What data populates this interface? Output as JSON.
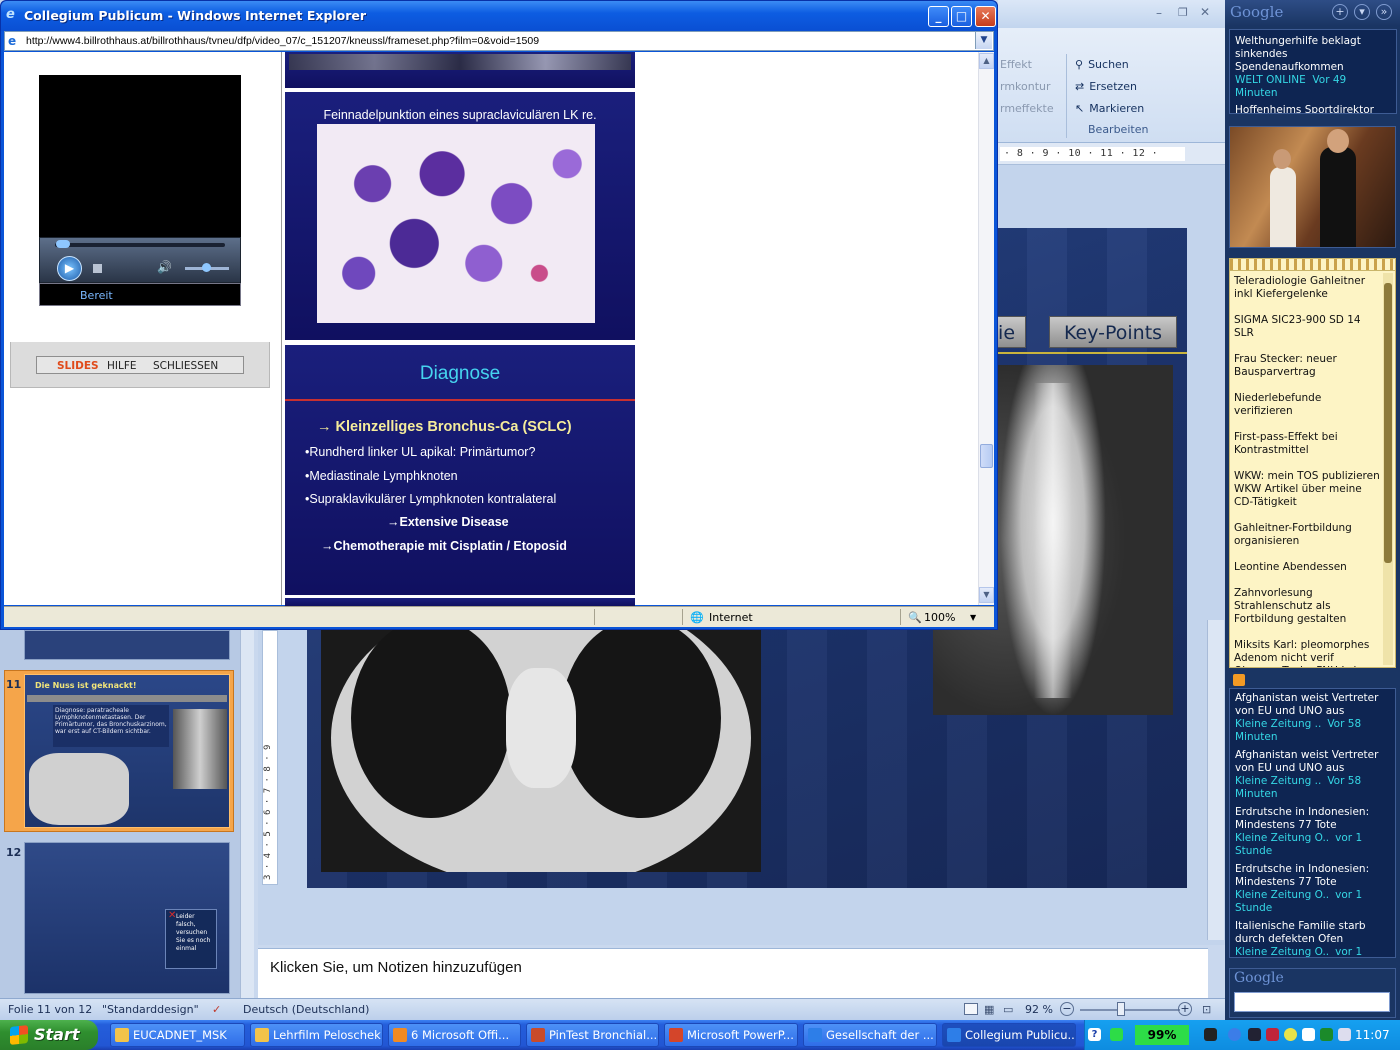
{
  "ie": {
    "title": "Collegium Publicum - Windows Internet Explorer",
    "address": "http://www4.billrothhaus.at/billrothhaus/tvneu/dfp/video_07/c_151207/kneussl/frameset.php?film=0&void=1509",
    "status_zone": "Internet",
    "zoom": "100%"
  },
  "player": {
    "status": "Bereit",
    "menu": [
      "SLIDES",
      "HILFE",
      "SCHLIESSEN"
    ]
  },
  "slides": {
    "cytology_title": "Feinnadelpunktion eines supraclaviculären LK re.",
    "diagnosis_title": "Diagnose",
    "diagnosis_main": "→ Kleinzelliges Bronchus-Ca (SCLC)",
    "diagnosis_lines": [
      "•Rundherd linker UL apikal: Primärtumor?",
      "•Mediastinale Lymphknoten",
      "•Supraklavikulärer Lymphknoten kontralateral"
    ],
    "extensive": "→Extensive Disease",
    "therapy": "→Chemotherapie mit Cisplatin / Etoposid"
  },
  "powerpoint": {
    "ribbon": {
      "effects": [
        "Effekt",
        "rmkontur",
        "rmeffekte"
      ],
      "search": "Suchen",
      "replace": "Ersetzen",
      "select": "Markieren",
      "group": "Bearbeiten"
    },
    "ruler": "· 8 · 9 · 10 · 11 · 12 ·",
    "vruler": "3 · 4 · 5 · 6 · 7 · 8 · 9",
    "slide_tabs": [
      "gie",
      "Key-Points"
    ],
    "thumb11_title": "Die Nuss ist geknackt!",
    "thumb11_text": "Diagnose: paratracheale Lymphknotenmetastasen. Der Primärtumor, das Bronchuskarzinom, war erst auf CT-Bildern sichtbar.",
    "thumb12_text": "Leider falsch, versuchen Sie es noch einmal",
    "thumb_numbers": [
      "11",
      "12"
    ],
    "notes": "Klicken Sie, um  Notizen hinzuzufügen",
    "status": {
      "slide": "Folie 11 von 12",
      "design": "\"Standarddesign\"",
      "language": "Deutsch (Deutschland)",
      "zoom": "92 %"
    }
  },
  "sidebar": {
    "logo": "Google",
    "news_top": [
      {
        "headline": "Welthungerhilfe beklagt sinkendes Spendenaufkommen",
        "source": "WELT ONLINE",
        "time": "Vor 49 Minuten"
      },
      {
        "headline": "Hoffenheims Sportdirektor Peters: Ein Vordenker",
        "source": "",
        "time": ""
      }
    ],
    "todo": [
      "Teleradiologie Gahleitner inkl Kiefergelenke",
      "SIGMA SIC23-900 SD 14 SLR",
      "Frau Stecker: neuer Bausparvertrag",
      "Niederlebefunde verifizieren",
      "First-pass-Effekt bei Kontrastmittel",
      "WKW: mein TOS publizieren WKW Artikel über meine CD-Tätigkeit",
      "Gahleitner-Fortbildung organisieren",
      "Leontine Abendessen",
      "Zahnvorlesung Strahlenschutz als Fortbildung gestalten",
      "Miksits Karl: pleomorphes Adenom nicht verif Obmann Tanja: FNH Leber: auch CT und US"
    ],
    "news": [
      {
        "headline": "Afghanistan weist Vertreter von EU und UNO aus",
        "source": "Kleine Zeitung ..",
        "time": "Vor 58 Minuten"
      },
      {
        "headline": "Afghanistan weist Vertreter von EU und UNO aus",
        "source": "Kleine Zeitung ..",
        "time": "Vor 58 Minuten"
      },
      {
        "headline": "Erdrutsche in Indonesien: Mindestens 77 Tote",
        "source": "Kleine Zeitung O..",
        "time": "vor 1 Stunde"
      },
      {
        "headline": "Erdrutsche in Indonesien: Mindestens 77 Tote",
        "source": "Kleine Zeitung O..",
        "time": "vor 1 Stunde"
      },
      {
        "headline": "Italienische Familie starb durch defekten Ofen",
        "source": "Kleine Zeitung O..",
        "time": "vor 1 Stunde"
      },
      {
        "headline": "Italienische Familie starb durch defekten Ofen",
        "source": "Kleine Zeitung O..",
        "time": "vor 1 Stunde"
      }
    ],
    "search_logo": "Google"
  },
  "taskbar": {
    "start": "Start",
    "items": [
      "EUCADNET_MSK",
      "Lehrfilm Peloschek",
      "6 Microsoft Offi...",
      "PinTest Bronchial...",
      "Microsoft PowerP...",
      "Gesellschaft der ...",
      "Collegium Publicu..."
    ],
    "battery": "99%",
    "clock": "11:07"
  },
  "colors": {
    "xp_blue": "#0a55d8",
    "slide_navy": "#101060",
    "accent_cyan": "#35d7e5"
  }
}
